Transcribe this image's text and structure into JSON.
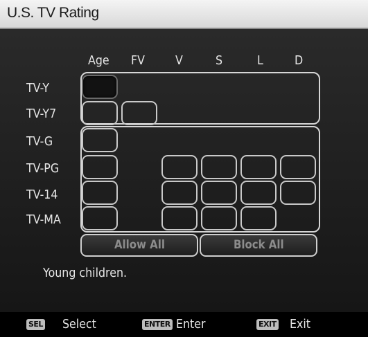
{
  "title": "U.S. TV Rating",
  "columns": [
    "Age",
    "FV",
    "V",
    "S",
    "L",
    "D"
  ],
  "rows": [
    "TV-Y",
    "TV-Y7",
    "TV-G",
    "TV-PG",
    "TV-14",
    "TV-MA"
  ],
  "buttons": {
    "allow_all": "Allow All",
    "block_all": "Block All"
  },
  "message": "Young children.",
  "footer": {
    "select_key": "SEL",
    "select_label": "Select",
    "enter_key": "ENTER",
    "enter_label": "Enter",
    "exit_key": "EXIT",
    "exit_label": "Exit"
  },
  "grid": {
    "TV-Y": [
      "Age"
    ],
    "TV-Y7": [
      "Age",
      "FV"
    ],
    "TV-G": [
      "Age"
    ],
    "TV-PG": [
      "Age",
      "V",
      "S",
      "L",
      "D"
    ],
    "TV-14": [
      "Age",
      "V",
      "S",
      "L",
      "D"
    ],
    "TV-MA": [
      "Age",
      "V",
      "S",
      "L"
    ],
    "selected_cell": "TV-Y.Age"
  },
  "colors": {
    "title_bar": "#e6e6e6",
    "background": "#1f1f1f",
    "cell_border": "#c9c9c9",
    "footer": "#000000"
  }
}
